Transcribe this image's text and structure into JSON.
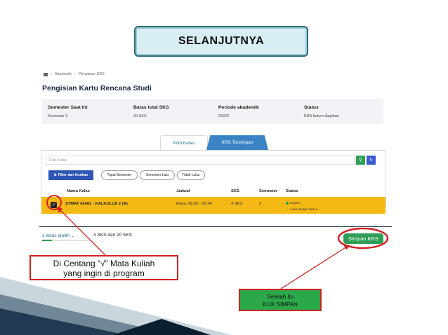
{
  "slide_title": "SELANJUTNYA",
  "breadcrumb": [
    "Akademik",
    "Pengisian KRS"
  ],
  "page_title": "Pengisian Kartu Rencana Studi",
  "summary": [
    {
      "label": "Semester Saat Ini",
      "value": "Semester 3"
    },
    {
      "label": "Batas total SKS",
      "value": "20 SKS"
    },
    {
      "label": "Periode akademik",
      "value": "20222"
    },
    {
      "label": "Status",
      "value": "KRS belum diajukan"
    }
  ],
  "tabs": {
    "pilih": "Pilih Kelas",
    "tersimpan": "KRS Tersimpan"
  },
  "search": {
    "placeholder": "Cari Kelas"
  },
  "filter_button": "Filter dan Urutkan",
  "chips": [
    "Tepat Semester",
    "Semester Lalu",
    "Tidak Lulus"
  ],
  "table": {
    "headers": {
      "nama": "Nama Kelas",
      "jadwal": "Jadwal",
      "sks": "SKS",
      "semester": "Semester",
      "status": "Status"
    },
    "row": {
      "nama": "STMAT 42402 - KALKULUS 2 (A)",
      "jadwal": "Rabu, 08:00 - 09:40",
      "sks": "4 SKS",
      "semester": "2",
      "status1": "Reguler",
      "status2": "Lulus dengan Nilai A"
    }
  },
  "footer": {
    "kelas_dipilih": "1 kelas dipilih",
    "sks_info": "4 SKS dari 20 SKS",
    "progress_fraction": 0.2
  },
  "simpan_button": "Simpan KRS",
  "note_left": {
    "line1": "Di Centang “√” Mata Kuliah",
    "line2": "yang ingin di program"
  },
  "note_right": {
    "line1": "Setelah itu",
    "line2": "KLIK SIMPAN"
  },
  "colors": {
    "accent_green": "#2e9e56",
    "highlight_yellow": "#f5b915",
    "annotation_red": "#d32121",
    "tab_blue": "#3a84c6"
  }
}
